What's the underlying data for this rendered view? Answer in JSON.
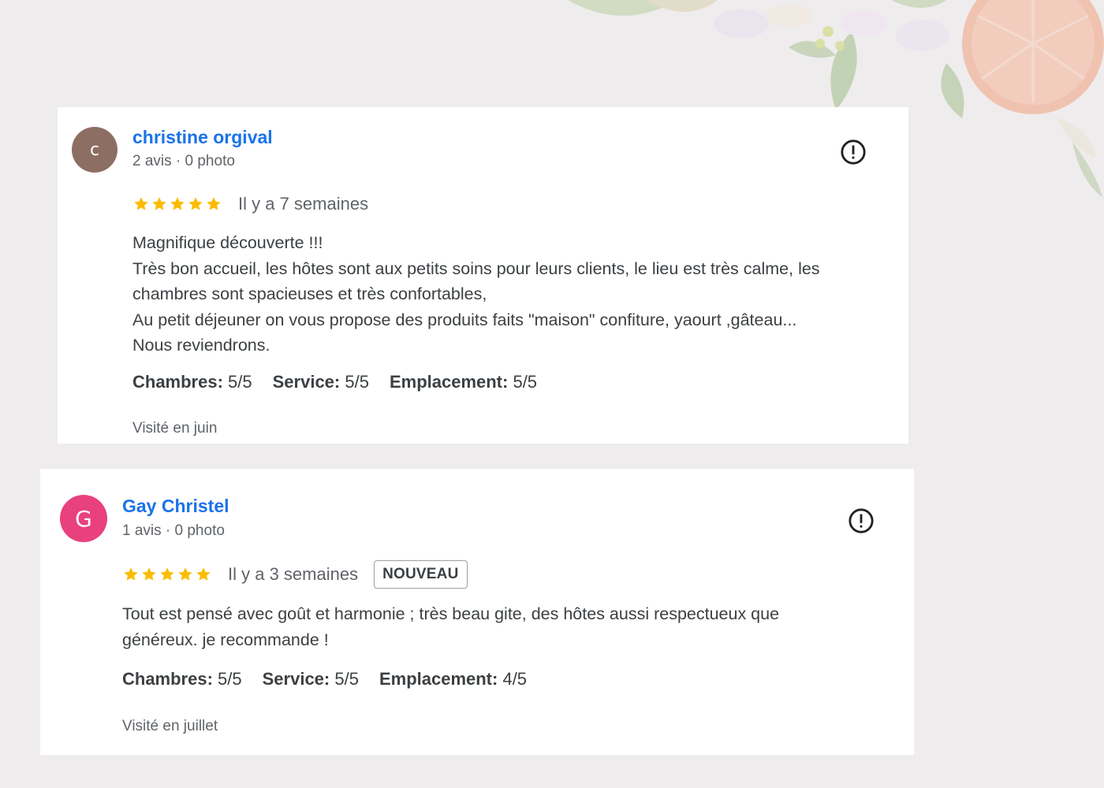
{
  "colors": {
    "page_bg": "#efecee",
    "link": "#1a73e8",
    "star": "#fbbc04",
    "avatar_brown": "#8d6e63",
    "avatar_pink": "#e8417d"
  },
  "reviews": [
    {
      "avatar_letter": "c",
      "avatar_color": "#8d6e63",
      "author": "christine orgival",
      "meta": "2 avis · 0 photo",
      "stars": 5,
      "time": "Il y a 7 semaines",
      "badge": "",
      "text": [
        "Magnifique découverte !!!",
        "Très bon accueil, les hôtes sont aux petits soins pour leurs clients, le lieu est très calme, les",
        "chambres sont spacieuses et très confortables,",
        "Au petit déjeuner on vous propose des produits faits \"maison\" confiture, yaourt ,gâteau...",
        "Nous reviendrons."
      ],
      "scores": [
        {
          "label": "Chambres:",
          "value": "5/5"
        },
        {
          "label": "Service:",
          "value": "5/5"
        },
        {
          "label": "Emplacement:",
          "value": "5/5"
        }
      ],
      "visited": "Visité en juin"
    },
    {
      "avatar_letter": "G",
      "avatar_color": "#e8417d",
      "author": "Gay Christel",
      "meta": "1 avis · 0 photo",
      "stars": 5,
      "time": "Il y a 3 semaines",
      "badge": "NOUVEAU",
      "text": [
        "Tout est pensé avec goût et harmonie ; très beau gite, des hôtes aussi respectueux que",
        "généreux. je recommande !"
      ],
      "scores": [
        {
          "label": "Chambres:",
          "value": "5/5"
        },
        {
          "label": "Service:",
          "value": "5/5"
        },
        {
          "label": "Emplacement:",
          "value": "4/5"
        }
      ],
      "visited": "Visité en juillet"
    }
  ]
}
